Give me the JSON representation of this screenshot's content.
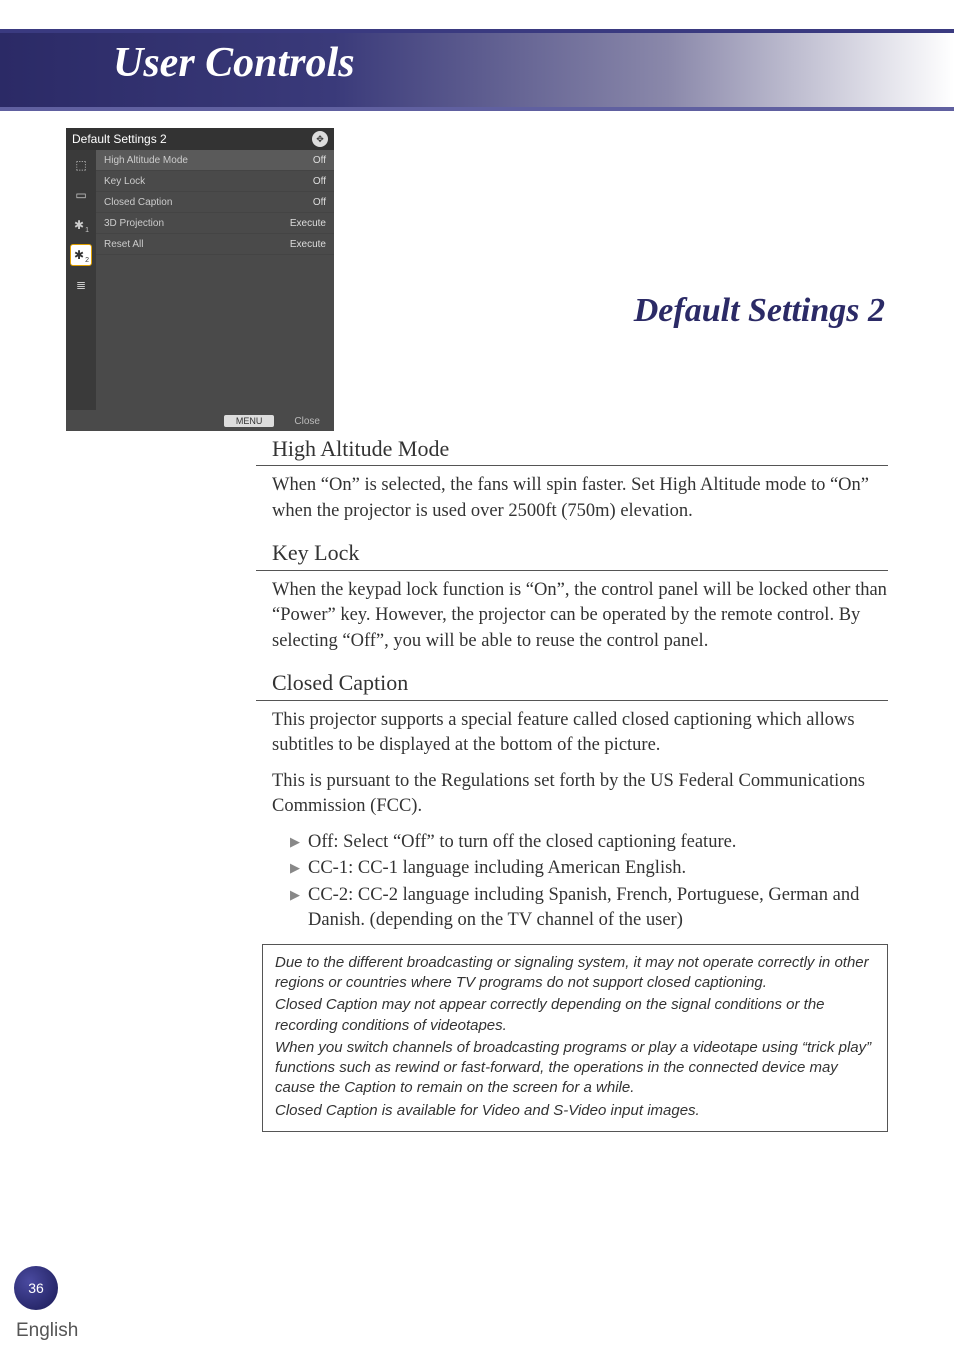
{
  "header": {
    "title": "User Controls"
  },
  "osd": {
    "title": "Default Settings 2",
    "sidebar": [
      {
        "name": "sb-display",
        "glyph": "⬚",
        "selected": false
      },
      {
        "name": "sb-image",
        "glyph": "▭",
        "selected": false
      },
      {
        "name": "sb-setup1",
        "glyph": "✱",
        "sub": "1",
        "selected": false
      },
      {
        "name": "sb-setup2",
        "glyph": "✱",
        "sub": "2",
        "selected": true
      },
      {
        "name": "sb-info",
        "glyph": "≣",
        "selected": false
      }
    ],
    "rows": [
      {
        "label": "High Altitude Mode",
        "value": "Off"
      },
      {
        "label": "Key Lock",
        "value": "Off"
      },
      {
        "label": "Closed Caption",
        "value": "Off"
      },
      {
        "label": "3D Projection",
        "value": "Execute"
      },
      {
        "label": "Reset All",
        "value": "Execute"
      }
    ],
    "footer": {
      "menu": "MENU",
      "close": "Close"
    }
  },
  "section_title": "Default Settings 2",
  "sections": {
    "ham": {
      "heading": "High Altitude Mode",
      "p1": "When “On” is selected, the fans will spin faster. Set High Altitude mode to “On” when the projector is used over 2500ft (750m) eleva­tion."
    },
    "keylock": {
      "heading": "Key Lock",
      "p1": "When the keypad lock function is “On”, the control panel will be locked other than “Power” key. However, the projector can be oper­ated by the remote control. By selecting “Off”, you will be able to reuse the control panel."
    },
    "cc": {
      "heading": "Closed Caption",
      "p1": "This projector supports a special feature called closed captioning which allows subtitles to be displayed at the bottom of the picture.",
      "p2": "This is pursuant to the Regulations set forth by the US Federal Com­munications Commission (FCC).",
      "bullets": [
        "Off: Select “Off” to turn off the closed captioning feature.",
        "CC-1: CC-1 language including American English.",
        "CC-2: CC-2 language including Spanish, French, Portuguese, German and Danish. (depending on the TV channel of the user)"
      ]
    }
  },
  "note": {
    "p1": "Due to the different broadcasting or signaling system, it may not operate correctly in other regions or countries where TV programs do not support closed captioning.",
    "p2": "Closed Caption may not appear correctly depending on the signal conditions or the recording conditions of videotapes.",
    "p3": "When you switch channels of broadcasting programs or play a videotape using “trick play” functions such as rewind or fast-forward, the operations in the connected device may cause the Caption to remain on the screen for a while.",
    "p4": "Closed Caption is available for Video and S-Video input images."
  },
  "footer": {
    "page": "36",
    "language": "English"
  }
}
